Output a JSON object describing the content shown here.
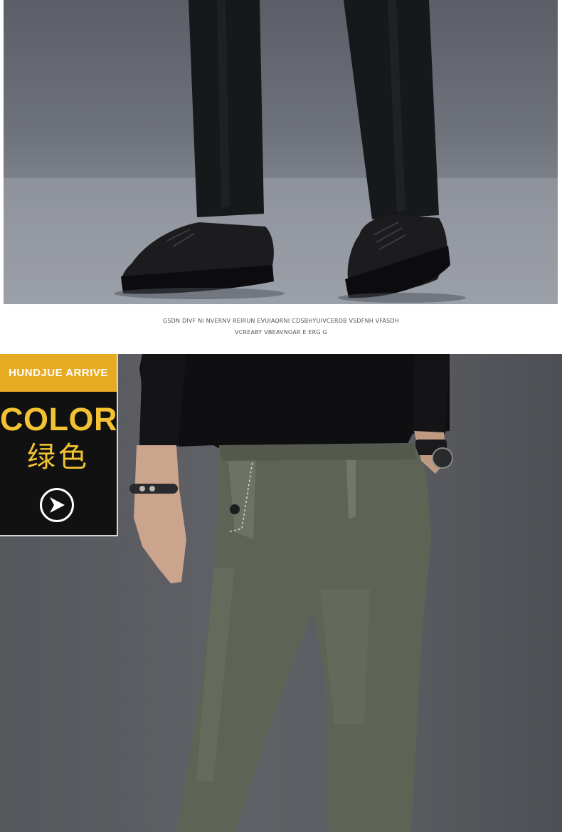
{
  "caption": {
    "line1": "GSDN DIVF NI NVERNV REIRUN EVUIAQRNI CDSBHYUIVCERDB VSDFNH VFASDH",
    "line2": "VCREABY VBEAVNOAR E ERG G"
  },
  "badge": {
    "header": "HUNDJUE ARRIVE",
    "title": "COLOR",
    "color_name": "绿色",
    "play_icon": "play-icon"
  },
  "colors": {
    "badge_gold": "#e6ab22",
    "badge_text": "#f2c232",
    "badge_bg": "#111111"
  }
}
